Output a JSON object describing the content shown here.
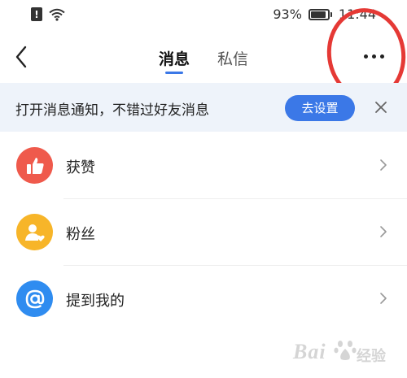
{
  "status_bar": {
    "alert_icon": "exclamation-icon",
    "wifi_icon": "wifi-icon",
    "battery_percent": "93%",
    "battery_level": 0.93,
    "time": "11:44"
  },
  "header": {
    "back_icon": "chevron-left-icon",
    "tabs": [
      {
        "label": "消息",
        "active": true
      },
      {
        "label": "私信",
        "active": false
      }
    ],
    "more_icon": "more-dots-icon",
    "accent_color": "#3b78e7",
    "annotation_color": "#e53935"
  },
  "banner": {
    "text": "打开消息通知，不错过好友消息",
    "button_label": "去设置",
    "close_icon": "close-icon",
    "background": "#eef3fa"
  },
  "list": {
    "items": [
      {
        "label": "获赞",
        "icon": "thumbs-up-icon",
        "color": "#ef5a4c"
      },
      {
        "label": "粉丝",
        "icon": "follower-icon",
        "color": "#f7b529"
      },
      {
        "label": "提到我的",
        "icon": "at-sign-icon",
        "color": "#2f8cf0"
      }
    ]
  },
  "watermark": {
    "text": "Bai",
    "sub": "经验"
  }
}
